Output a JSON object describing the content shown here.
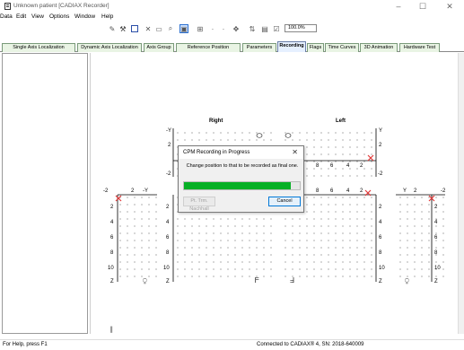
{
  "window": {
    "title": "Unknown patient [CADIAX Recorder]",
    "minimize": "–",
    "maximize": "☐",
    "close": "✕"
  },
  "menu": [
    "Data",
    "Edit",
    "View",
    "Options",
    "Window",
    "Help"
  ],
  "toolbar": {
    "zoom_value": "100.0%"
  },
  "tabs": [
    {
      "label": "Single Axis Localization",
      "selected": false
    },
    {
      "label": "Dynamic Axis Localization",
      "selected": false
    },
    {
      "label": "Axis Group",
      "selected": false
    },
    {
      "label": "Reference Position",
      "selected": false
    },
    {
      "label": "Parameters",
      "selected": false
    },
    {
      "label": "Recording",
      "selected": true
    },
    {
      "label": "Flags",
      "selected": false
    },
    {
      "label": "Time Curves",
      "selected": false
    },
    {
      "label": "3D Animation",
      "selected": false
    },
    {
      "label": "Hardware Test",
      "selected": false
    }
  ],
  "canvas": {
    "label_right": "Right",
    "label_left": "Left",
    "y_axis": "Y",
    "z_axis": "Z",
    "neg_y": "-Y",
    "top_right_ticks": [
      "8",
      "6",
      "4",
      "2"
    ],
    "bottom_right_ticks": [
      "8",
      "6",
      "4",
      "2"
    ],
    "ticks_2": "2",
    "ticks_neg2": "-2",
    "z_ticks": [
      "2",
      "4",
      "6",
      "8",
      "10"
    ],
    "marker_color": "#e23a3a"
  },
  "dialog": {
    "title": "CPM Recording in Progress",
    "close": "✕",
    "message": "Change position to that to be recorded as final one.",
    "progress_pct": 92,
    "btn_left": "Pt. Trm. Nachhall",
    "btn_cancel": "Cancel"
  },
  "status": {
    "left": "For Help, press F1",
    "center": "Connected to CADIAX® 4, SN: 2018-640009"
  }
}
